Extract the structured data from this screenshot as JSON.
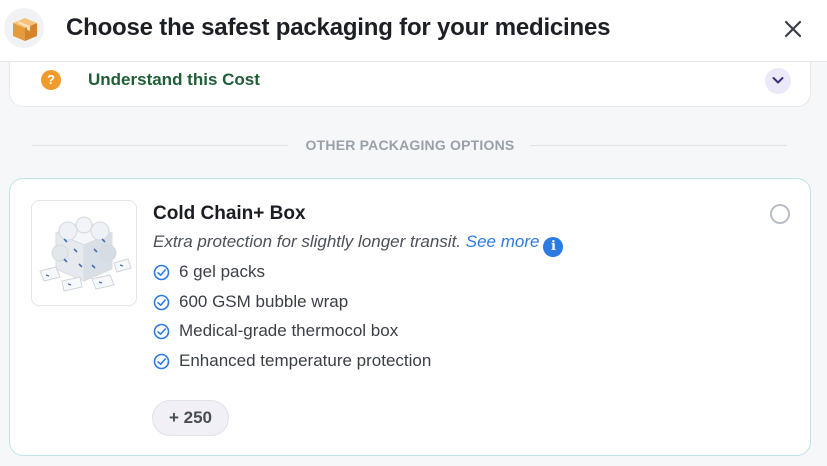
{
  "header": {
    "title": "Choose the safest packaging for your medicines",
    "icon": "package-box-icon"
  },
  "cost_info": {
    "label": "Understand this Cost",
    "icon": "question-icon",
    "toggle_icon": "chevron-down-icon"
  },
  "divider": {
    "label": "OTHER PACKAGING OPTIONS"
  },
  "option": {
    "title": "Cold Chain+ Box",
    "description": "Extra protection for slightly longer transit.",
    "see_more": "See more",
    "info_glyph": "i",
    "features": [
      "6 gel packs",
      "600 GSM bubble wrap",
      "Medical-grade thermocol box",
      "Enhanced temperature protection"
    ],
    "price": "+ 250",
    "selected": false
  },
  "colors": {
    "accent_blue": "#2c7be5",
    "cost_label_green": "#1f5e37",
    "question_orange": "#f39a2c",
    "card_border": "#bfe3e6"
  }
}
